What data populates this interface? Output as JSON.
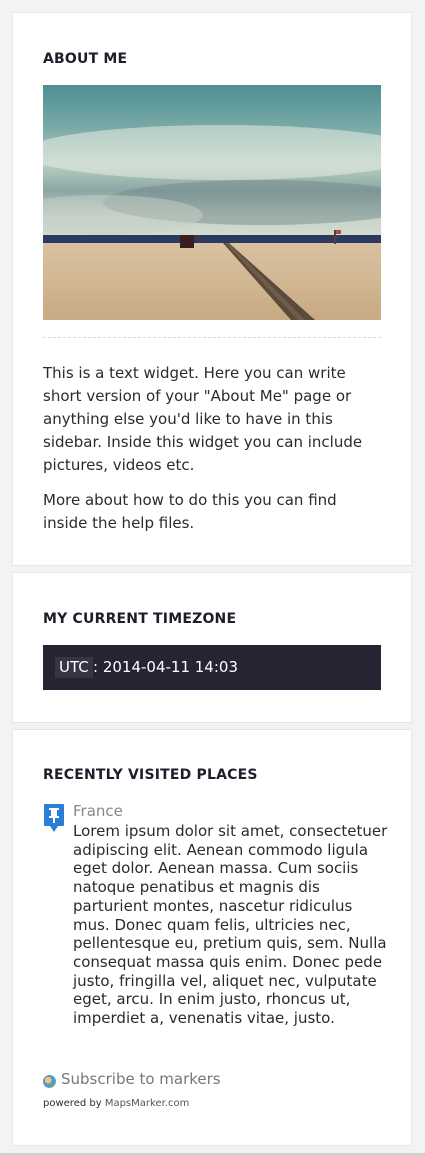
{
  "about": {
    "title": "ABOUT ME",
    "paragraph1": "This is a text widget. Here you can write short version of your \"About Me\" page or anything else you'd like to have in this sidebar. Inside this widget you can include pictures, videos etc.",
    "paragraph2": "More about how to do this you can find inside the help files."
  },
  "timezone": {
    "title": "MY CURRENT TIMEZONE",
    "zone_label": "UTC",
    "value": ": 2014-04-11 14:03"
  },
  "places": {
    "title": "RECENTLY VISITED PLACES",
    "marker_icon": "map-pin-icon",
    "items": [
      {
        "name": "France",
        "text": "Lorem ipsum dolor sit amet, consectetuer adipiscing elit. Aenean commodo ligula eget dolor. Aenean massa. Cum sociis natoque penatibus et magnis dis parturient montes, nascetur ridiculus mus. Donec quam felis, ultricies nec, pellentesque eu, pretium quis, sem. Nulla consequat massa quis enim. Donec pede justo, fringilla vel, aliquet nec, vulputate eget, arcu. In enim justo, rhoncus ut, imperdiet a, venenatis vitae, justo."
      }
    ],
    "subscribe_label": "Subscribe to markers",
    "powered_prefix": "powered by",
    "powered_link": "MapsMarker.com"
  },
  "colors": {
    "timezone_bar": "#252432",
    "pin_blue": "#2a7fd4"
  }
}
